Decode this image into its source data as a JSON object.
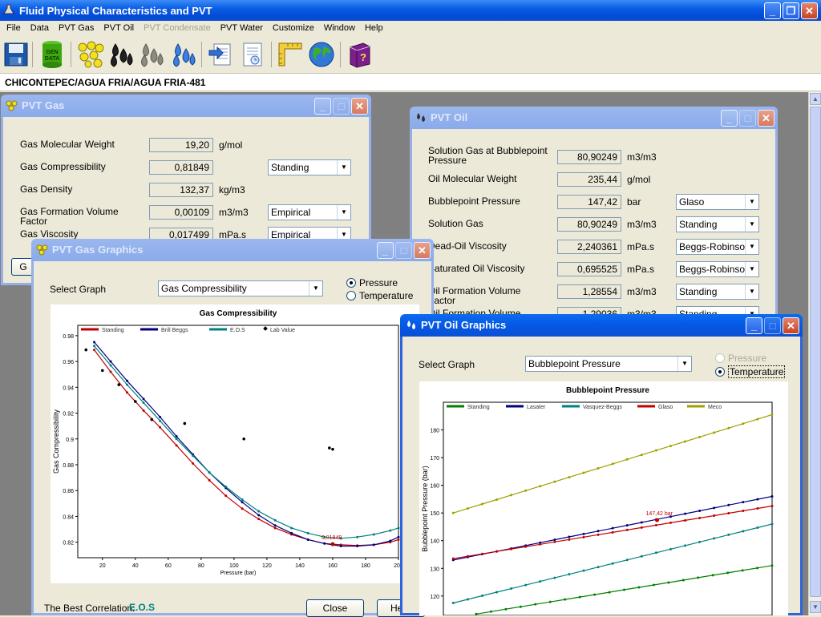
{
  "app": {
    "title": "Fluid Physical Characteristics and PVT",
    "menu": [
      "File",
      "Data",
      "PVT Gas",
      "PVT Oil",
      "PVT Condensate",
      "PVT Water",
      "Customize",
      "Window",
      "Help"
    ],
    "menu_disabled": [
      "PVT Condensate"
    ],
    "path": "CHICONTEPEC/AGUA FRIA/AGUA FRIA-481",
    "toolbar_icons": [
      "save-icon",
      "gen-data-icon",
      "gas-bubbles-icon",
      "oil-drops-icon",
      "condensate-drops-icon",
      "water-drops-icon",
      "import-icon",
      "report-icon",
      "ruler-icon",
      "globe-icon",
      "help-book-icon"
    ],
    "gen_data_label": "GEN DATA"
  },
  "pvt_gas": {
    "title": "PVT Gas",
    "rows": [
      {
        "label": "Gas Molecular Weight",
        "value": "19,20",
        "unit": "g/mol",
        "method": ""
      },
      {
        "label": "Gas Compressibility",
        "value": "0,81849",
        "unit": "",
        "method": "Standing"
      },
      {
        "label": "Gas Density",
        "value": "132,37",
        "unit": "kg/m3",
        "method": ""
      },
      {
        "label": "Gas Formation Volume Factor",
        "value": "0,00109",
        "unit": "m3/m3",
        "method": "Empirical"
      },
      {
        "label": "Gas Viscosity",
        "value": "0,017499",
        "unit": "mPa.s",
        "method": "Empirical"
      }
    ],
    "button_partial": "G"
  },
  "pvt_oil": {
    "title": "PVT Oil",
    "rows": [
      {
        "label": "Solution Gas at Bubblepoint Pressure",
        "value": "80,90249",
        "unit": "m3/m3",
        "method": ""
      },
      {
        "label": "Oil Molecular Weight",
        "value": "235,44",
        "unit": "g/mol",
        "method": ""
      },
      {
        "label": "Bubblepoint Pressure",
        "value": "147,42",
        "unit": "bar",
        "method": "Glaso"
      },
      {
        "label": "Solution Gas",
        "value": "80,90249",
        "unit": "m3/m3",
        "method": "Standing"
      },
      {
        "label": "Dead-Oil Viscosity",
        "value": "2,240361",
        "unit": "mPa.s",
        "method": "Beggs-Robinson"
      },
      {
        "label": "Saturated Oil Viscosity",
        "value": "0,695525",
        "unit": "mPa.s",
        "method": "Beggs-Robinson"
      },
      {
        "label": "Oil Formation Volume Factor",
        "value": "1,28554",
        "unit": "m3/m3",
        "method": "Standing"
      },
      {
        "label": "Oil Formation Volume Factor at",
        "value": "1,29036",
        "unit": "m3/m3",
        "method": "Standing"
      }
    ]
  },
  "gas_graphics": {
    "title": "PVT Gas Graphics",
    "select_label": "Select Graph",
    "selected": "Gas Compressibility",
    "radio_pressure": "Pressure",
    "radio_temperature": "Temperature",
    "best_label": "The Best Correlation:",
    "best_value": "E.O.S",
    "close_label": "Close",
    "help_partial": "He"
  },
  "oil_graphics": {
    "title": "PVT Oil Graphics",
    "select_label": "Select Graph",
    "selected": "Bubblepoint Pressure",
    "radio_pressure": "Pressure",
    "radio_temperature": "Temperature"
  },
  "chart_data": [
    {
      "type": "line",
      "title": "Gas Compressibility",
      "xlabel": "Pressure (bar)",
      "ylabel": "Gas Compressibility",
      "xlim": [
        5,
        200
      ],
      "ylim": [
        0.808,
        0.988
      ],
      "xticks": [
        20,
        40,
        60,
        80,
        100,
        120,
        140,
        160,
        180,
        200
      ],
      "yticks": [
        0.82,
        0.84,
        0.86,
        0.88,
        0.9,
        0.92,
        0.94,
        0.96,
        0.98
      ],
      "legend": "top",
      "annotation": {
        "text": "0,81849",
        "x": 160,
        "y": 0.8185
      },
      "series": [
        {
          "name": "Standing",
          "color": "#c00000",
          "x": [
            15,
            25,
            35,
            45,
            55,
            65,
            75,
            85,
            95,
            105,
            115,
            125,
            135,
            145,
            155,
            160,
            165,
            175,
            185,
            195,
            200
          ],
          "y": [
            0.969,
            0.952,
            0.936,
            0.922,
            0.909,
            0.895,
            0.881,
            0.868,
            0.856,
            0.846,
            0.838,
            0.831,
            0.826,
            0.822,
            0.819,
            0.8185,
            0.818,
            0.8175,
            0.818,
            0.82,
            0.822
          ]
        },
        {
          "name": "Brill Beggs",
          "color": "#000080",
          "x": [
            15,
            25,
            35,
            45,
            55,
            65,
            75,
            85,
            95,
            105,
            115,
            125,
            135,
            145,
            155,
            165,
            175,
            185,
            195,
            200
          ],
          "y": [
            0.975,
            0.96,
            0.945,
            0.931,
            0.917,
            0.902,
            0.888,
            0.874,
            0.862,
            0.851,
            0.841,
            0.833,
            0.827,
            0.822,
            0.819,
            0.817,
            0.817,
            0.818,
            0.821,
            0.824
          ]
        },
        {
          "name": "E.O.S",
          "color": "#008080",
          "x": [
            15,
            25,
            35,
            45,
            55,
            65,
            75,
            85,
            95,
            105,
            115,
            125,
            135,
            145,
            155,
            165,
            175,
            185,
            195,
            200
          ],
          "y": [
            0.972,
            0.957,
            0.942,
            0.928,
            0.914,
            0.9,
            0.887,
            0.874,
            0.863,
            0.853,
            0.844,
            0.837,
            0.831,
            0.827,
            0.824,
            0.823,
            0.824,
            0.826,
            0.829,
            0.831
          ]
        },
        {
          "name": "Lab Value",
          "color": "#000000",
          "markers_only": true,
          "x": [
            10,
            20,
            30,
            40,
            50,
            70,
            106,
            158,
            160
          ],
          "y": [
            0.969,
            0.953,
            0.942,
            0.929,
            0.915,
            0.912,
            0.9,
            0.893,
            0.892
          ]
        }
      ]
    },
    {
      "type": "line",
      "title": "Bubblepoint Pressure",
      "xlabel": "",
      "ylabel": "Bubblepoint Pressure (bar)",
      "xlim": [
        0,
        100
      ],
      "ylim": [
        113,
        190
      ],
      "yticks": [
        120,
        130,
        140,
        150,
        160,
        170,
        180
      ],
      "legend": "top",
      "annotation": {
        "text": "147,42 bar",
        "x": 65,
        "y": 147.42
      },
      "series": [
        {
          "name": "Standing",
          "color": "#008000",
          "x0": 10,
          "x1": 100,
          "y0": 113.5,
          "y1": 131.0,
          "points": 21
        },
        {
          "name": "Lasater",
          "color": "#000080",
          "x0": 3,
          "x1": 100,
          "y0": 133.0,
          "y1": 156.0,
          "points": 23
        },
        {
          "name": "Vasquez-Beggs",
          "color": "#008080",
          "x0": 3,
          "x1": 100,
          "y0": 117.5,
          "y1": 146.0,
          "points": 23
        },
        {
          "name": "Glaso",
          "color": "#c00000",
          "x0": 3,
          "x1": 100,
          "y0": 133.5,
          "y1": 152.5,
          "points": 23
        },
        {
          "name": "Meco",
          "color": "#a0a000",
          "x0": 3,
          "x1": 100,
          "y0": 150.0,
          "y1": 185.5,
          "points": 23
        }
      ]
    }
  ]
}
